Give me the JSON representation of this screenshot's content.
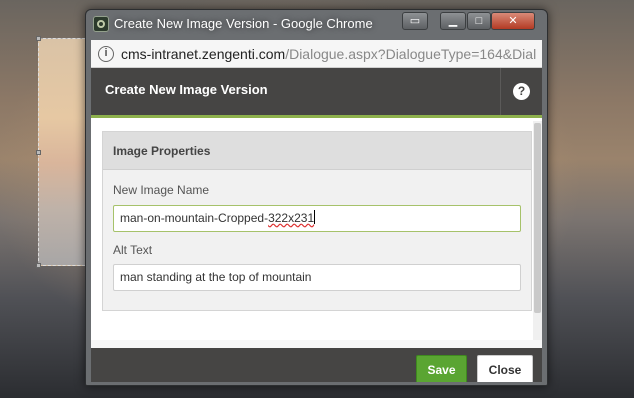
{
  "window": {
    "title": "Create New Image Version - Google Chrome",
    "icon": "app-icon",
    "controls": [
      "extra-button",
      "minimize-icon",
      "maximize-icon",
      "close-icon"
    ]
  },
  "address_bar": {
    "host": "cms-intranet.zengenti.com",
    "path": "/Dialogue.aspx?DialogueType=164&Dial"
  },
  "dialog": {
    "title": "Create New Image Version",
    "help_label": "?",
    "section": {
      "title": "Image Properties",
      "fields": [
        {
          "label": "New Image Name",
          "value_prefix": "man-on-mountain-Cropped-",
          "value_suffix": "322x231"
        },
        {
          "label": "Alt Text",
          "value": "man standing at the top of mountain"
        }
      ]
    },
    "buttons": {
      "save": "Save",
      "close": "Close"
    }
  },
  "colors": {
    "accent_green": "#8db04c",
    "save_button": "#5aa532",
    "header_bg": "#464544"
  }
}
